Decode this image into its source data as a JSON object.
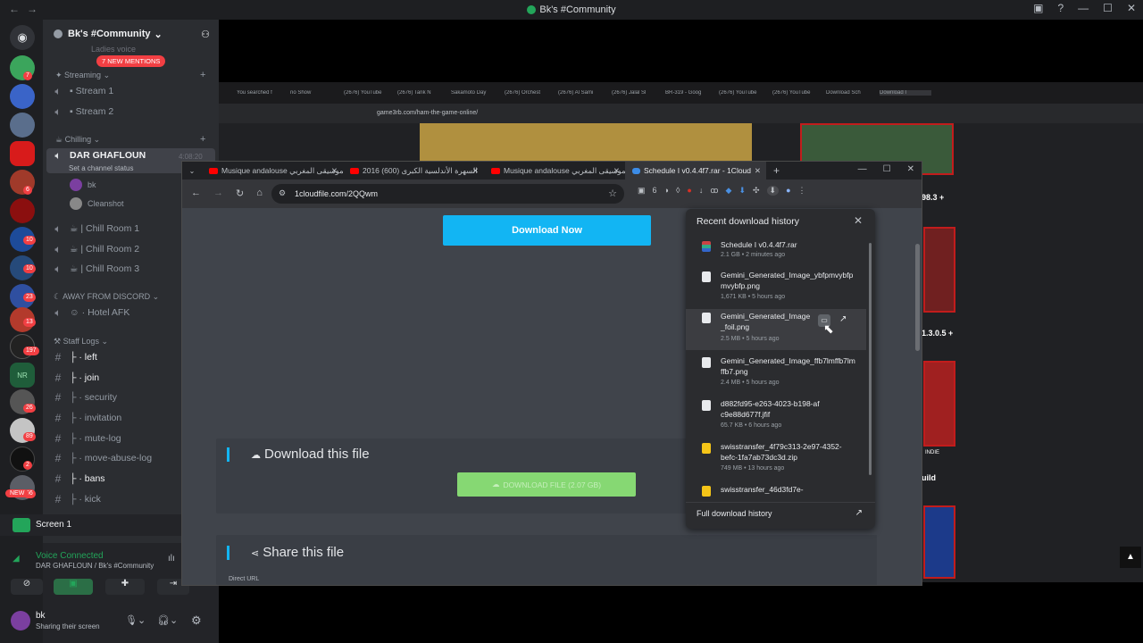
{
  "window": {
    "title": "Bk's #Community",
    "minimize": "—",
    "maximize": "☐",
    "close": "✕"
  },
  "server": {
    "name": "Bk's #Community",
    "new_mentions": "7 NEW MENTIONS",
    "hidden_top_channel": "Ladies voice",
    "categories": {
      "streaming": "Streaming",
      "chilling": "Chilling",
      "away": "AWAY FROM DISCORD",
      "staff": "Staff Logs"
    },
    "voice_channels": [
      {
        "label": "Stream 1"
      },
      {
        "label": "Stream 2"
      }
    ],
    "active_channel": {
      "label": "DAR GHAFLOUN",
      "status": "Set a channel status",
      "timer": "4:08:20"
    },
    "members": [
      {
        "name": "bk"
      },
      {
        "name": "Cleanshot"
      }
    ],
    "chill_rooms": [
      {
        "label": "| Chill Room 1"
      },
      {
        "label": "| Chill Room 2"
      },
      {
        "label": "| Chill Room 3"
      }
    ],
    "hotel": "Hotel AFK",
    "text_channels": [
      {
        "label": "left",
        "bold": true
      },
      {
        "label": "join",
        "bold": true
      },
      {
        "label": "security",
        "bold": false
      },
      {
        "label": "invitation",
        "bold": false
      },
      {
        "label": "mute-log",
        "bold": false
      },
      {
        "label": "move-abuse-log",
        "bold": false
      },
      {
        "label": "bans",
        "bold": true
      },
      {
        "label": "kick",
        "bold": false
      }
    ]
  },
  "guild_badges": [
    "7",
    "",
    "6",
    "",
    "6",
    "10",
    "10",
    "23",
    "13",
    "197",
    "",
    "26",
    "89",
    "2",
    "66"
  ],
  "new_badge": "NEW",
  "screen_share": {
    "label": "Screen 1"
  },
  "voice": {
    "status": "Voice Connected",
    "channel": "DAR GHAFLOUN / Bk's #Community"
  },
  "user": {
    "name": "bk",
    "status": "Sharing their screen"
  },
  "back_browser": {
    "tabs": [
      "You searched f",
      "no Show",
      "(2676) YouTube",
      "(2676) Tarik N",
      "Sakamoto Day",
      "(2676) Orchest",
      "(2676) Al Sami",
      "(2676) Jalal Sl",
      "BR-319 - Goog",
      "(2676) YouTube",
      "(2676) YouTube",
      "Download Sch",
      "Download I"
    ],
    "url": "game3rb.com/ham-the-game-online/",
    "right_texts": {
      "a": "98.3 +",
      "b": "1.3.0.5 +",
      "c": "uild",
      "d": "INDIE"
    }
  },
  "browser": {
    "tabs": [
      {
        "label": "Musique andalouse الموسيقى المغربي",
        "active": false
      },
      {
        "label": "2016 السهرة الأندلسية الكبرى (600)",
        "active": false
      },
      {
        "label": "Musique andalouse الموسيقى المغربي",
        "active": false
      },
      {
        "label": "Schedule I v0.4.4f7.rar - 1Cloud",
        "active": true
      }
    ],
    "url": "1cloudfile.com/2QQwm",
    "download_now": "Download Now",
    "download_this_file": "Download this file",
    "download_file_button": "DOWNLOAD FILE (2.07 GB)",
    "share_this_file": "Share this file",
    "direct_url": "Direct URL"
  },
  "download_panel": {
    "title": "Recent download history",
    "items": [
      {
        "name": "Schedule I v0.4.4f7.rar",
        "meta": "2.1 GB • 2 minutes ago",
        "type": "rar"
      },
      {
        "name": "Gemini_Generated_Image_ybfpmvybfpmvybfp.png",
        "meta": "1,671 KB • 5 hours ago",
        "type": "file"
      },
      {
        "name": "Gemini_Generated_Image_foil.png",
        "meta": "2.5 MB • 5 hours ago",
        "type": "file"
      },
      {
        "name": "Gemini_Generated_Image_ffb7lmffb7lmffb7.png",
        "meta": "2.4 MB • 5 hours ago",
        "type": "file"
      },
      {
        "name": "d882fd95-e263-4023-b198-afc9e88d677f.jfif",
        "meta": "65.7 KB • 6 hours ago",
        "type": "file"
      },
      {
        "name": "swisstransfer_4f79c313-2e97-4352-befc-1fa7ab73dc3d.zip",
        "meta": "749 MB • 13 hours ago",
        "type": "zip"
      },
      {
        "name": "swisstransfer_46d3fd7e-",
        "meta": "",
        "type": "zip"
      }
    ],
    "footer": "Full download history"
  },
  "colors": {
    "discord_bg": "#2b2d31",
    "accent": "#12b5f3",
    "green": "#86d873",
    "mention_red": "#f23f43",
    "voice_green": "#23a55a"
  }
}
